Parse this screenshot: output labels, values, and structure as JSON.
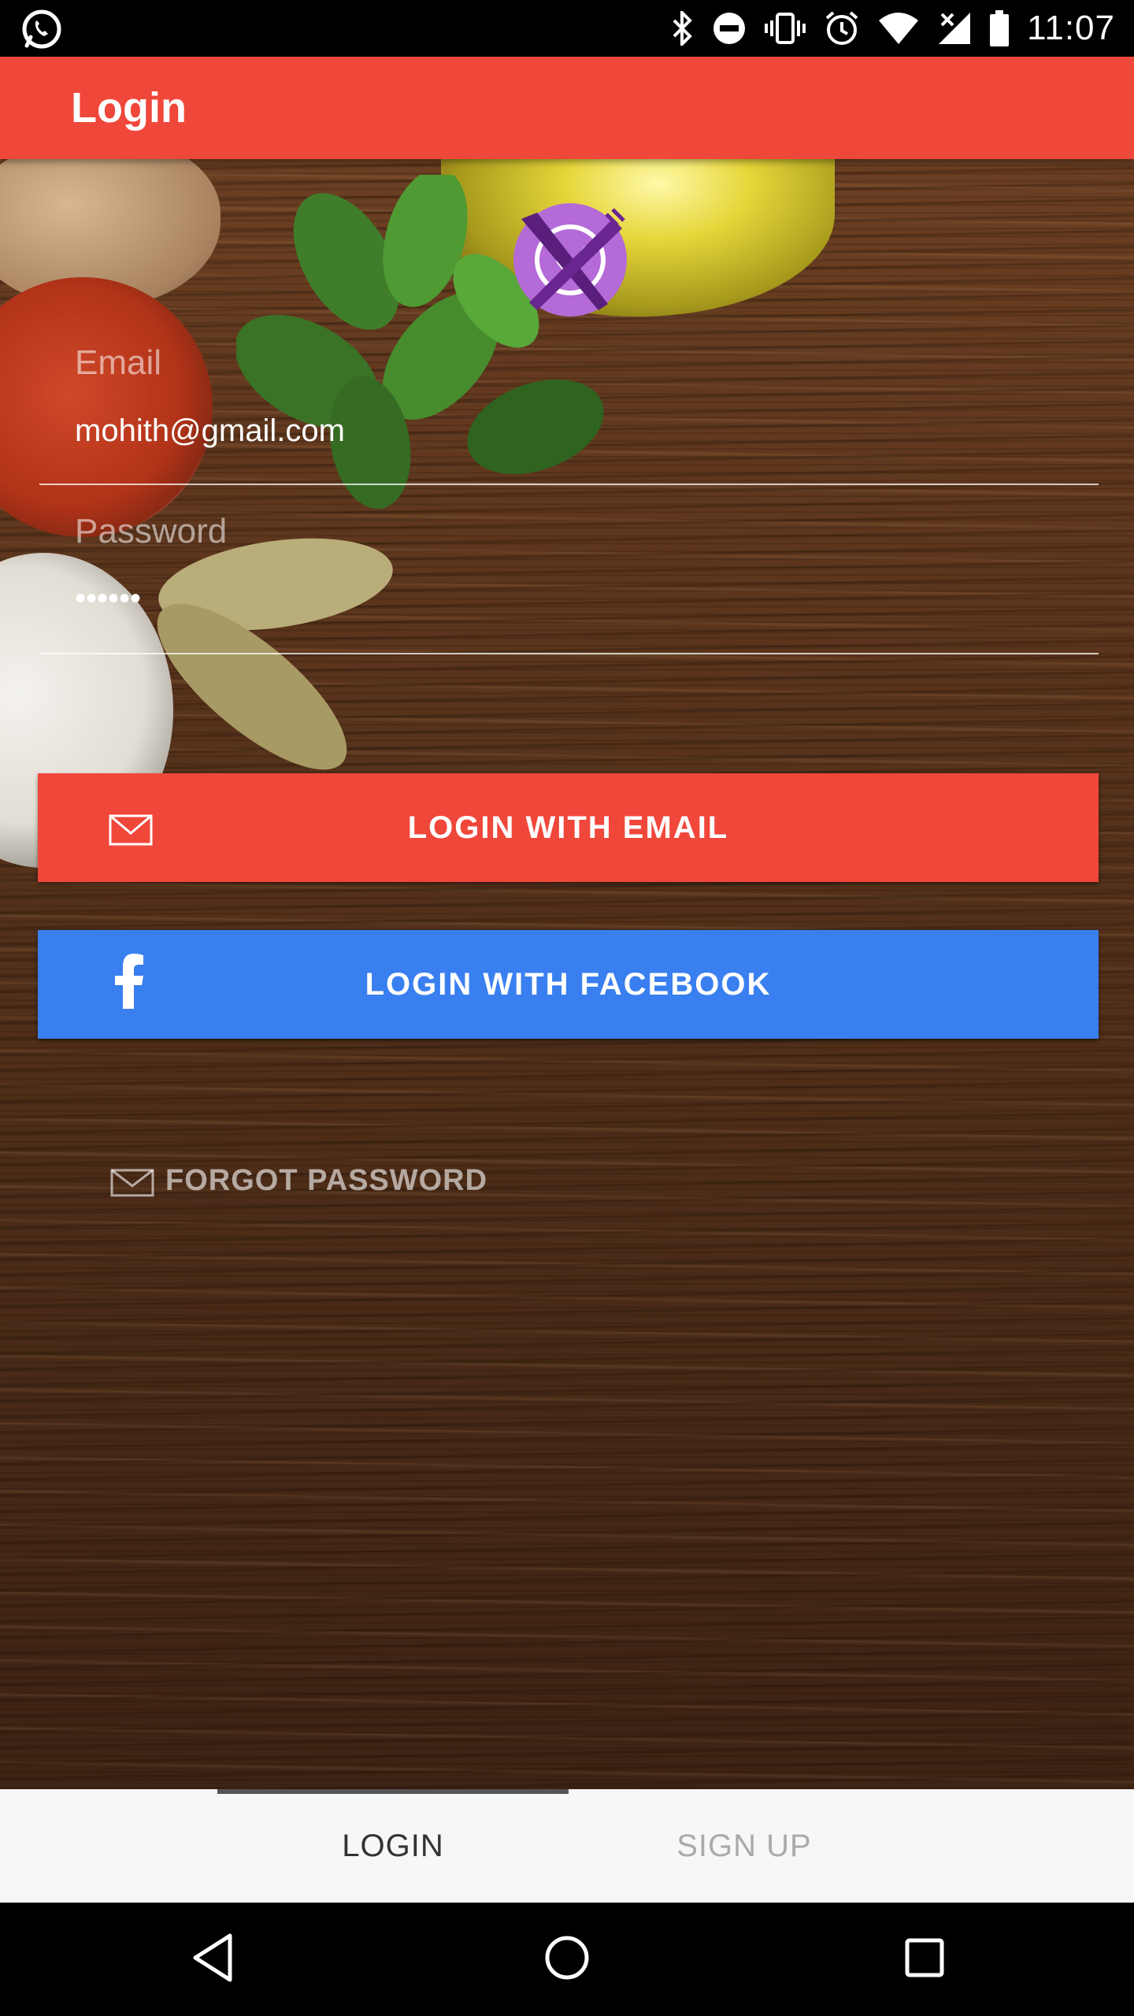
{
  "status_bar": {
    "time": "11:07",
    "icons": [
      "whatsapp-icon",
      "bluetooth-icon",
      "do-not-disturb-icon",
      "vibrate-icon",
      "alarm-icon",
      "wifi-icon",
      "signal-icon",
      "battery-icon"
    ]
  },
  "app_bar": {
    "title": "Login"
  },
  "logo": {
    "icon": "restaurant-logo-icon"
  },
  "form": {
    "email": {
      "label": "Email",
      "value": "mohith@gmail.com"
    },
    "password": {
      "label": "Password",
      "value": "••••••"
    }
  },
  "buttons": {
    "email_login": "LOGIN WITH EMAIL",
    "facebook_login": "LOGIN WITH FACEBOOK",
    "forgot_password": "FORGOT PASSWORD"
  },
  "tabs": [
    {
      "label": "LOGIN",
      "selected": true
    },
    {
      "label": "SIGN UP",
      "selected": false
    }
  ],
  "colors": {
    "primary": "#f0473b",
    "facebook": "#397ff0",
    "logo": "#b46ad7"
  },
  "nav_bar": {
    "icons": [
      "back-icon",
      "home-icon",
      "recents-icon"
    ]
  }
}
